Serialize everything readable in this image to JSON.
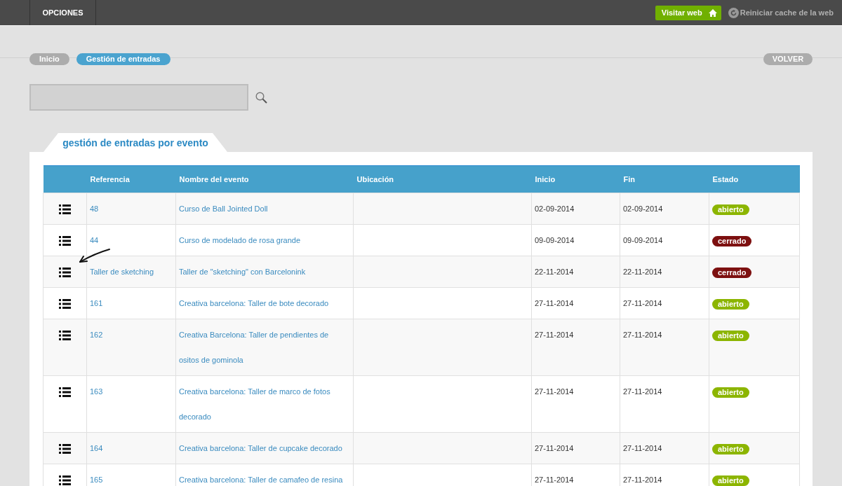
{
  "topbar": {
    "menu": "OPCIONES",
    "visit_button": "Visitar web",
    "cache_link": "Reiniciar cache de la web"
  },
  "breadcrumbs": [
    {
      "label": "Inicio",
      "selected": false
    },
    {
      "label": "Gestión de entradas",
      "selected": true
    }
  ],
  "back_button": "VOLVER",
  "panel_tab": "gestión de entradas por evento",
  "table": {
    "columns": [
      "Referencia",
      "Nombre del evento",
      "Ubicación",
      "Inicio",
      "Fin",
      "Estado"
    ],
    "rows": [
      {
        "reference": "48",
        "event": "Curso de Ball Jointed Doll",
        "start": "02-09-2014",
        "end": "02-09-2014",
        "status": {
          "label": "abierto",
          "color": "#8cb500"
        }
      },
      {
        "reference": "44",
        "event": "Curso de modelado de rosa grande",
        "start": "09-09-2014",
        "end": "09-09-2014",
        "status": {
          "label": "cerrado",
          "color": "#7d1010"
        }
      },
      {
        "reference": "Taller de sketching",
        "event": "Taller de \"sketching\" con Barcelonink",
        "start": "22-11-2014",
        "end": "22-11-2014",
        "status": {
          "label": "cerrado",
          "color": "#7d1010"
        }
      },
      {
        "reference": "161",
        "event": "Creativa barcelona: Taller de bote decorado",
        "start": "27-11-2014",
        "end": "27-11-2014",
        "status": {
          "label": "abierto",
          "color": "#8cb500"
        }
      },
      {
        "reference": "162",
        "event": "Creativa Barcelona: Taller de pendientes de ositos de gominola",
        "start": "27-11-2014",
        "end": "27-11-2014",
        "status": {
          "label": "abierto",
          "color": "#8cb500"
        }
      },
      {
        "reference": "163",
        "event": "Creativa barcelona: Taller de marco de fotos decorado",
        "start": "27-11-2014",
        "end": "27-11-2014",
        "status": {
          "label": "abierto",
          "color": "#8cb500"
        }
      },
      {
        "reference": "164",
        "event": "Creativa barcelona: Taller de cupcake decorado",
        "start": "27-11-2014",
        "end": "27-11-2014",
        "status": {
          "label": "abierto",
          "color": "#8cb500"
        }
      },
      {
        "reference": "165",
        "event": "Creativa barcelona: Taller de camafeo de resina",
        "start": "27-11-2014",
        "end": "27-11-2014",
        "status": {
          "label": "abierto",
          "color": "#8cb500"
        }
      }
    ]
  }
}
